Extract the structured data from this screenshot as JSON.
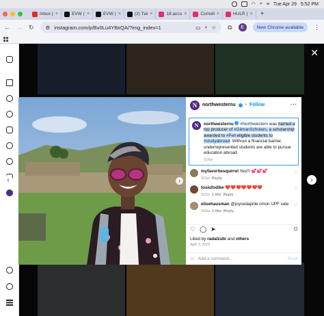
{
  "menubar": {
    "date": "Tue Apr 29",
    "time": "5:52 PM"
  },
  "tabs": [
    {
      "label": "Inbox (",
      "favicon": "#d93025"
    },
    {
      "label": "EVW (",
      "favicon": "#111111"
    },
    {
      "label": "EVW (",
      "favicon": "#111111"
    },
    {
      "label": "(2) Twi",
      "favicon": "#111111"
    },
    {
      "label": "18 accu",
      "favicon": "#e1306c"
    },
    {
      "label": "Cornell",
      "favicon": "#e1306c"
    },
    {
      "label": "HULR (",
      "favicon": "#e1306c"
    }
  ],
  "toolbar": {
    "url": "instagram.com/p/Bv0Lu4YBxQA/?img_index=1",
    "profile_initial": "E",
    "new_chrome_label": "New Chrome available"
  },
  "post": {
    "username": "northwesternu",
    "follow_label": "Follow",
    "caption_username": "northwesternu",
    "caption": {
      "part1": "#Northwestern",
      "part2": " was ",
      "part3": "named a top producer of ",
      "part4": "#GilmanScholars",
      "part5": ", a scholarship awarded to ",
      "part6": "#Pell",
      "part7": " eligible students to ",
      "part8": "#studyabroad",
      "part9": ". Without a financial barrier, underrepresented students are able to pursue education abroad."
    },
    "caption_time": "316w",
    "comments": [
      {
        "user": "myfavoritesquirrel",
        "text": "Yes!!! 💕💕💕",
        "time": "311w",
        "likes": "",
        "reply": "Reply",
        "avatar": "#8a7a5c"
      },
      {
        "user": "tosiufodike",
        "text": "❤️❤️❤️❤️❤️❤️❤️",
        "time": "311w",
        "likes": "1 like",
        "reply": "Reply",
        "avatar": "#6b4a3a"
      },
      {
        "user": "elisehausman",
        "text": "@joycedaprile cmon UPF vale",
        "time": "316w",
        "likes": "1 like",
        "reply": "Reply",
        "avatar": "#a58b6f"
      }
    ],
    "likes_prefix": "Liked by ",
    "liked_by": "radalzubi",
    "likes_and": " and ",
    "likes_others": "others",
    "date": "April 3, 2019",
    "add_comment_placeholder": "Add a comment...",
    "post_label": "Post"
  }
}
